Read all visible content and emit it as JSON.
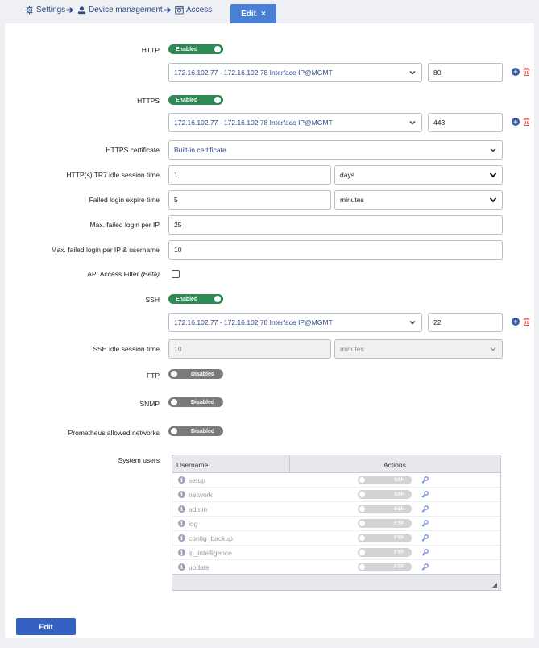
{
  "breadcrumb": {
    "settings": "Settings",
    "device_management": "Device management",
    "access": "Access",
    "active_tab": "Edit",
    "close_glyph": "×"
  },
  "colors": {
    "accent": "#4a7fd6",
    "enabled": "#2d8a55",
    "disabled": "#7a7a7a",
    "delete": "#d9534f"
  },
  "form": {
    "http": {
      "label": "HTTP",
      "toggle": "Enabled",
      "interface": "172.16.102.77 - 172.16.102.78 Interface IP@MGMT",
      "port": "80"
    },
    "https": {
      "label": "HTTPS",
      "toggle": "Enabled",
      "interface": "172.16.102.77 - 172.16.102.78 Interface IP@MGMT",
      "port": "443"
    },
    "https_certificate": {
      "label": "HTTPS certificate",
      "value": "Built-in certificate"
    },
    "idle_session": {
      "label": "HTTP(s) TR7 idle session time",
      "value": "1",
      "unit": "days"
    },
    "failed_login_expire": {
      "label": "Failed login expire time",
      "value": "5",
      "unit": "minutes"
    },
    "max_failed_ip": {
      "label": "Max. failed login per IP",
      "value": "25"
    },
    "max_failed_ip_user": {
      "label": "Max. failed login per IP & username",
      "value": "10"
    },
    "api_filter": {
      "label": "API Access Filter",
      "label_italic": "(Beta)",
      "checked": false
    },
    "ssh": {
      "label": "SSH",
      "toggle": "Enabled",
      "interface": "172.16.102.77 - 172.16.102.78 Interface IP@MGMT",
      "port": "22"
    },
    "ssh_idle": {
      "label": "SSH idle session time",
      "value": "10",
      "unit": "minutes"
    },
    "ftp": {
      "label": "FTP",
      "toggle": "Disabled"
    },
    "snmp": {
      "label": "SNMP",
      "toggle": "Disabled"
    },
    "prometheus": {
      "label": "Prometheus allowed networks",
      "toggle": "Disabled"
    },
    "system_users": {
      "label": "System users",
      "columns": [
        "Username",
        "Actions"
      ],
      "rows": [
        {
          "username": "setup",
          "service": "SSH"
        },
        {
          "username": "network",
          "service": "SSH"
        },
        {
          "username": "admin",
          "service": "SSH"
        },
        {
          "username": "log",
          "service": "FTP"
        },
        {
          "username": "config_backup",
          "service": "FTP"
        },
        {
          "username": "ip_intelligence",
          "service": "FTP"
        },
        {
          "username": "update",
          "service": "FTP"
        }
      ]
    }
  },
  "footer": {
    "edit_button": "Edit"
  }
}
